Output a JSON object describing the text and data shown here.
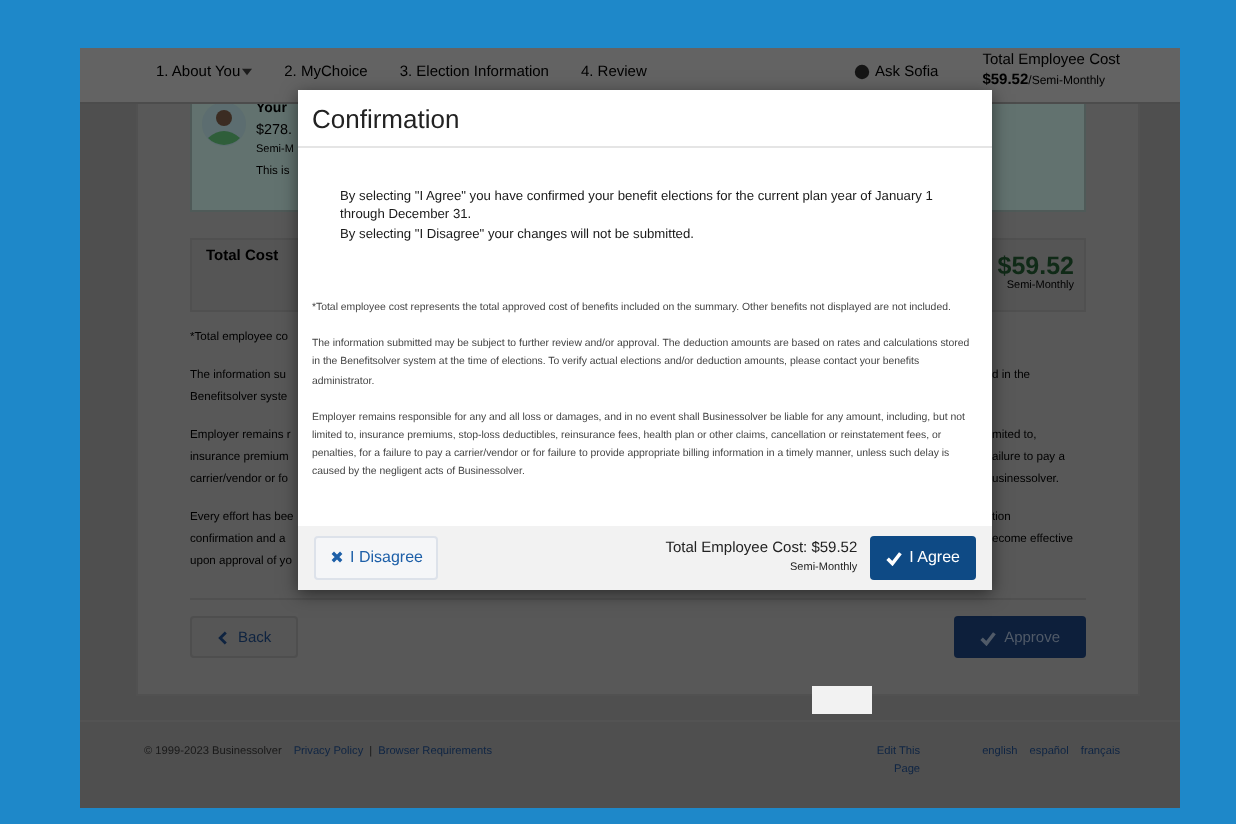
{
  "nav": {
    "steps": [
      {
        "label": "1. About You",
        "dropdown": true
      },
      {
        "label": "2. MyChoice",
        "dropdown": false
      },
      {
        "label": "3. Election Information",
        "dropdown": false
      },
      {
        "label": "4. Review",
        "dropdown": false
      }
    ],
    "assistant": "Ask Sofia",
    "cost_title": "Total Employee Cost",
    "cost_amount": "$59.52",
    "cost_period": "/Semi-Monthly"
  },
  "summary": {
    "profile": {
      "name": "Your",
      "amount": "$278.",
      "period": "Semi-M",
      "note": "This is"
    },
    "total": {
      "label": "Total Cost",
      "amount": "$59.52",
      "period": "Semi-Monthly"
    },
    "paragraphs": [
      {
        "left": [
          "*Total employee co"
        ]
      },
      {
        "left": [
          "The information su",
          "Benefitsolver syste"
        ],
        "right": [
          "d in the"
        ]
      },
      {
        "left": [
          "Employer remains r",
          "insurance premium",
          "carrier/vendor or fo"
        ],
        "right": [
          "mited to,",
          "ailure to pay a",
          "usinessolver."
        ]
      },
      {
        "left": [
          "Every effort has bee",
          "confirmation and a",
          "upon approval of yo"
        ],
        "right": [
          "tion",
          "ecome effective"
        ]
      }
    ],
    "back": "Back",
    "approve": "Approve"
  },
  "footer": {
    "copyright": "© 1999-2023 Businessolver",
    "links": [
      "Privacy Policy",
      "Browser Requirements"
    ],
    "separator": "|",
    "edit": "Edit This Page",
    "languages": [
      "english",
      "español",
      "français"
    ]
  },
  "modal": {
    "title": "Confirmation",
    "intro": [
      "By selecting \"I Agree\" you have confirmed your benefit elections for the current plan year of January 1 through December 31.",
      "By selecting \"I Disagree\" your changes will not be submitted."
    ],
    "fine_print": [
      "*Total employee cost represents the total approved cost of benefits included on the summary. Other benefits not displayed are not included.",
      "The information submitted may be subject to further review and/or approval. The deduction amounts are based on rates and calculations stored in the Benefitsolver system at the time of elections. To verify actual elections and/or deduction amounts, please contact your benefits administrator.",
      "Employer remains responsible for any and all loss or damages, and in no event shall Businessolver be liable for any amount, including, but not limited to, insurance premiums, stop-loss deductibles, reinsurance fees, health plan or other claims, cancellation or reinstatement fees, or penalties, for a failure to pay a carrier/vendor or for failure to provide appropriate billing information in a timely manner, unless such delay is caused by the negligent acts of Businessolver."
    ],
    "disagree": "I Disagree",
    "total": "Total Employee Cost: $59.52",
    "period": "Semi-Monthly",
    "agree": "I Agree"
  }
}
